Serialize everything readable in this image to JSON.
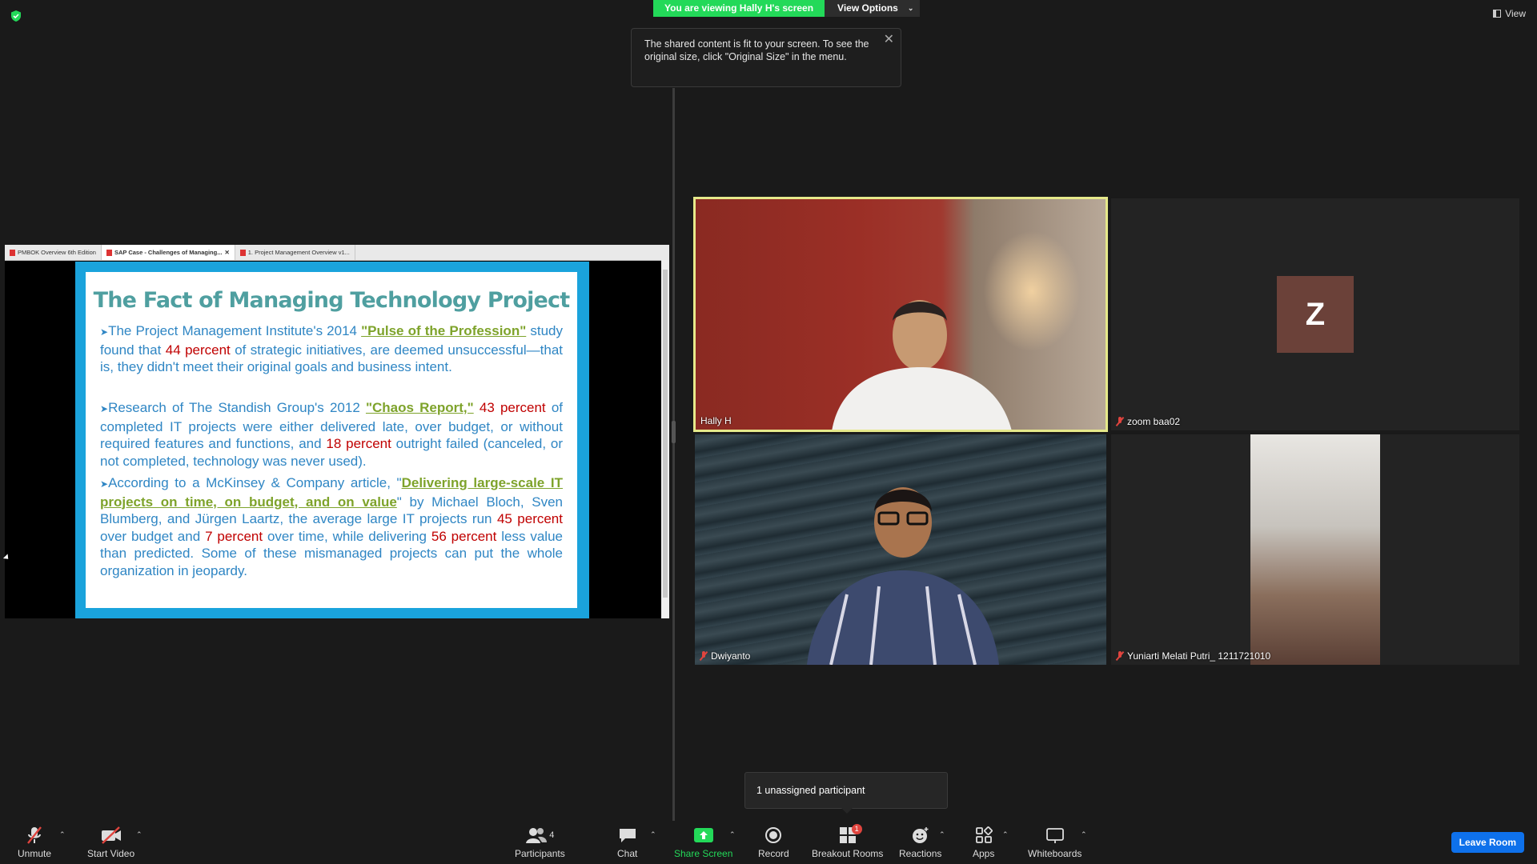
{
  "banner": {
    "viewing": "You are viewing Hally H's screen",
    "view_options": "View Options"
  },
  "view_button": "View",
  "tooltip": {
    "text": "The shared content is fit to your screen. To see the original size, click \"Original Size\" in the menu."
  },
  "shared": {
    "tabs": [
      {
        "label": "PMBOK Overview 6th Edition"
      },
      {
        "label": "SAP Case - Challenges of Managing..."
      },
      {
        "label": "1. Project Management Overview v1..."
      }
    ],
    "slide": {
      "title": "The Fact of Managing Technology Project",
      "b1": {
        "t1": "The Project Management Institute's 2014 ",
        "link": "\"Pulse of the Profession\"",
        "t2": " study found that ",
        "red": "44 percent",
        "t3": " of strategic initiatives, are deemed unsuccessful—that is, they didn't meet their original goals and business intent."
      },
      "b2": {
        "t1": "Research of The Standish Group's 2012 ",
        "link": "\"Chaos Report,\"",
        "red1": " 43 percent",
        "t2": " of completed IT projects were either delivered late, over budget, or without required features and functions, and ",
        "red2": "18 percent",
        "t3": " outright failed (canceled, or not completed, technology was never used)."
      },
      "b3": {
        "t1": "According to a McKinsey & Company article, \"",
        "link": "Delivering large-scale IT projects on time, on budget, and on value",
        "t2": "\" by Michael Bloch, Sven Blumberg, and Jürgen Laartz, the average large IT projects run ",
        "red1": "45 percent",
        "t3": " over budget and ",
        "red2": "7 percent",
        "t4": " over time, while delivering ",
        "red3": "56 percent",
        "t5": " less value than predicted.  Some of these mismanaged projects can put the whole organization in jeopardy."
      }
    }
  },
  "participants": [
    {
      "name": "Hally H"
    },
    {
      "name": "zoom baa02",
      "avatar": "Z"
    },
    {
      "name": "Dwiyanto"
    },
    {
      "name": "Yuniarti Melati Putri_ 1211721010"
    }
  ],
  "popover": {
    "text": "1 unassigned participant"
  },
  "toolbar": {
    "unmute": "Unmute",
    "start_video": "Start Video",
    "participants": "Participants",
    "participants_count": "4",
    "chat": "Chat",
    "share_screen": "Share Screen",
    "record": "Record",
    "breakout_rooms": "Breakout Rooms",
    "breakout_badge": "1",
    "reactions": "Reactions",
    "apps": "Apps",
    "whiteboards": "Whiteboards",
    "leave": "Leave Room"
  },
  "colors": {
    "share_green": "#23d959",
    "active_speaker": "#e6e98a",
    "leave_blue": "#0e71eb",
    "muted_red": "#e0443e"
  }
}
